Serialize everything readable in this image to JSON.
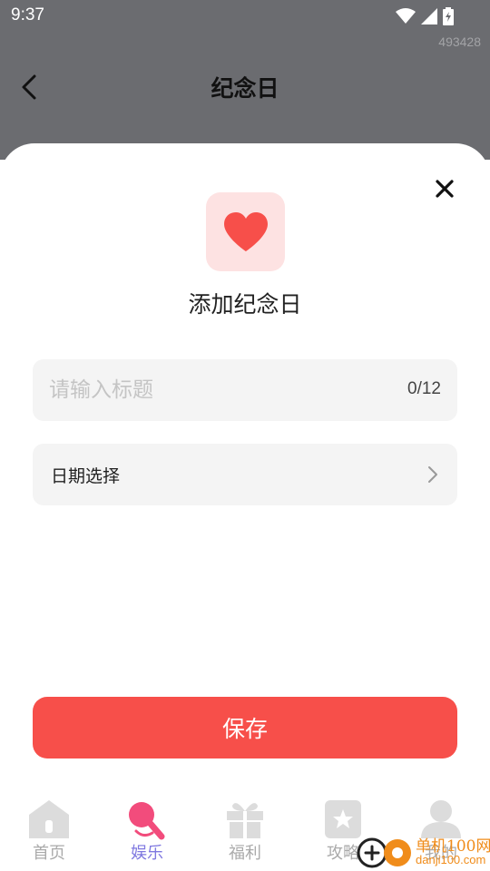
{
  "status_bar": {
    "time": "9:37",
    "build_number": "493428"
  },
  "header": {
    "title": "纪念日"
  },
  "sheet": {
    "title": "添加纪念日",
    "title_field": {
      "placeholder": "请输入标题",
      "value": "",
      "char_count": "0/12"
    },
    "date_field": {
      "label": "日期选择"
    },
    "save_label": "保存"
  },
  "tabs": [
    {
      "label": "首页",
      "icon": "home-icon",
      "active": false
    },
    {
      "label": "娱乐",
      "icon": "microphone-icon",
      "active": true
    },
    {
      "label": "福利",
      "icon": "gift-icon",
      "active": false
    },
    {
      "label": "攻略",
      "icon": "guide-star-icon",
      "active": false
    },
    {
      "label": "我的",
      "icon": "profile-icon",
      "active": false
    }
  ],
  "watermark": {
    "name": "单机100网",
    "url": "danji100.com"
  },
  "colors": {
    "accent_red": "#f74f4a",
    "heart_bg": "#fde2e2",
    "active_tab": "#7f78e0",
    "overlay": "#6b6c70"
  }
}
